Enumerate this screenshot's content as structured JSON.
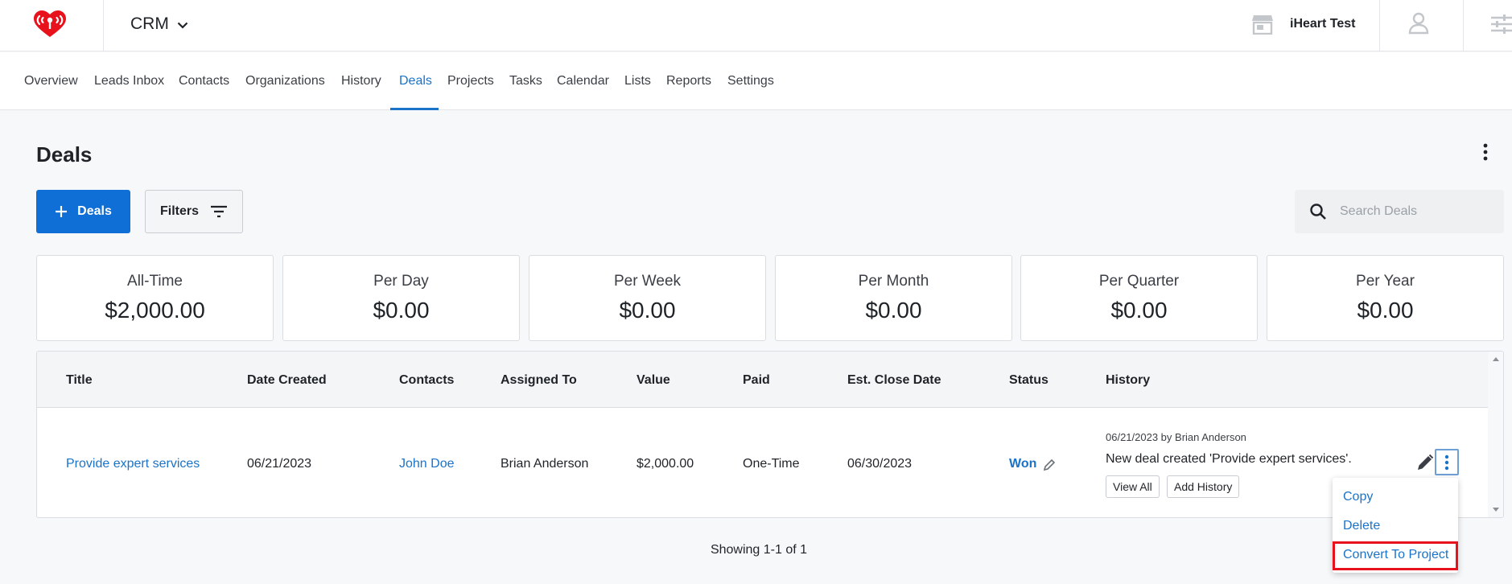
{
  "header": {
    "logo_icon": "iheart-logo-icon",
    "app_name": "CRM",
    "account_name": "iHeart Test",
    "brand_color": "#e8121c",
    "accent_color": "#1a73c9"
  },
  "nav": {
    "items": [
      "Overview",
      "Leads Inbox",
      "Contacts",
      "Organizations",
      "History",
      "Deals",
      "Projects",
      "Tasks",
      "Calendar",
      "Lists",
      "Reports",
      "Settings"
    ],
    "active": "Deals"
  },
  "page": {
    "title": "Deals",
    "add_button": "Deals",
    "filters_button": "Filters",
    "search_placeholder": "Search Deals"
  },
  "stats": [
    {
      "label": "All-Time",
      "value": "$2,000.00"
    },
    {
      "label": "Per Day",
      "value": "$0.00"
    },
    {
      "label": "Per Week",
      "value": "$0.00"
    },
    {
      "label": "Per Month",
      "value": "$0.00"
    },
    {
      "label": "Per Quarter",
      "value": "$0.00"
    },
    {
      "label": "Per Year",
      "value": "$0.00"
    }
  ],
  "table": {
    "columns": [
      "Title",
      "Date Created",
      "Contacts",
      "Assigned To",
      "Value",
      "Paid",
      "Est. Close Date",
      "Status",
      "History"
    ],
    "rows": [
      {
        "title": "Provide expert services",
        "date_created": "06/21/2023",
        "contacts": "John Doe",
        "assigned_to": "Brian Anderson",
        "value": "$2,000.00",
        "paid": "One-Time",
        "est_close_date": "06/30/2023",
        "status": "Won",
        "history_meta": "06/21/2023 by Brian Anderson",
        "history_text": "New deal created 'Provide expert services'.",
        "view_all": "View All",
        "add_history": "Add History"
      }
    ]
  },
  "row_menu": {
    "items": [
      "Copy",
      "Delete",
      "Convert To Project"
    ],
    "highlighted": "Convert To Project"
  },
  "footer": {
    "showing": "Showing 1-1 of 1"
  }
}
